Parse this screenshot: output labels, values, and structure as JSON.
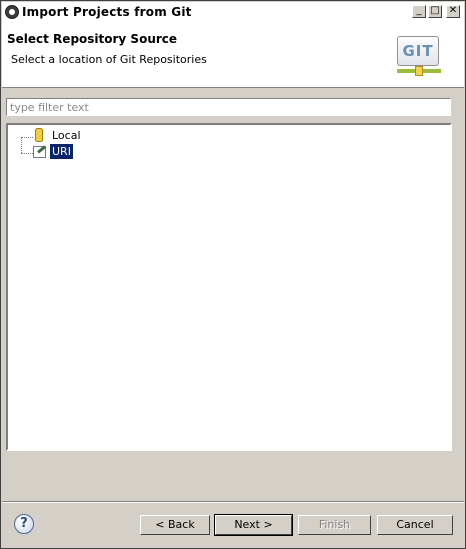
{
  "window": {
    "title": "Import Projects from Git",
    "controls": {
      "minimize": "_",
      "maximize": "□",
      "close": "✕"
    }
  },
  "header": {
    "title": "Select Repository Source",
    "subtitle": "Select a location of Git Repositories",
    "logo_text": "GIT"
  },
  "filter": {
    "placeholder": "type filter text",
    "value": ""
  },
  "tree": {
    "items": [
      {
        "label": "Local",
        "icon": "repository-icon",
        "selected": false
      },
      {
        "label": "URI",
        "icon": "uri-icon",
        "selected": true
      }
    ]
  },
  "footer": {
    "help": "?",
    "back_label": "< Back",
    "next_label": "Next >",
    "finish_label": "Finish",
    "cancel_label": "Cancel"
  }
}
